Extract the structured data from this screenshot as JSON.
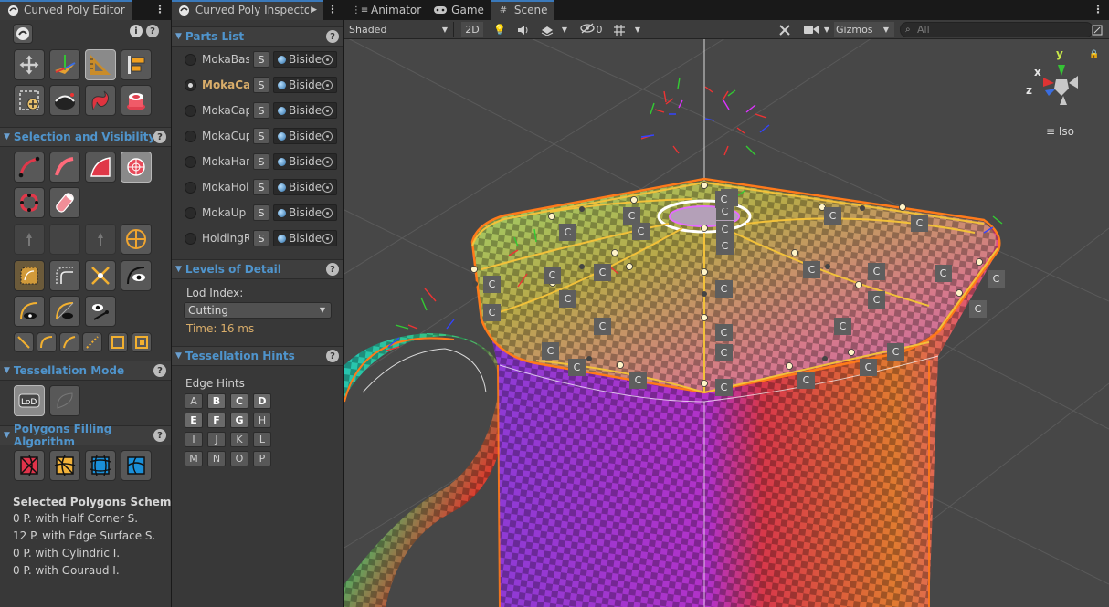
{
  "editor": {
    "tab_title": "Curved Poly Editor",
    "sections": {
      "selection": "Selection and Visibility",
      "tessellation_mode": "Tessellation Mode",
      "filling": "Polygons Filling Algorithm"
    },
    "schema_title": "Selected Polygons Schema",
    "schema_lines": [
      "0 P. with Half Corner S.",
      "12 P. with Edge Surface S.",
      "0 P. with Cylindric I.",
      "0 P. with Gouraud I."
    ]
  },
  "inspector": {
    "tab_title": "Curved Poly Inspector",
    "parts_list_title": "Parts List",
    "parts": [
      {
        "name": "MokaBase",
        "s": "S",
        "material": "Biside"
      },
      {
        "name": "MokaCap",
        "s": "S",
        "material": "Biside"
      },
      {
        "name": "MokaCap",
        "s": "S",
        "material": "Biside"
      },
      {
        "name": "MokaCup",
        "s": "S",
        "material": "Biside"
      },
      {
        "name": "MokaHandle",
        "s": "S",
        "material": "Biside"
      },
      {
        "name": "MokaHole",
        "s": "S",
        "material": "Biside"
      },
      {
        "name": "MokaUp",
        "s": "S",
        "material": "Biside"
      },
      {
        "name": "HoldingR",
        "s": "S",
        "material": "Biside"
      }
    ],
    "selected_part_index": 1,
    "lod_title": "Levels of Detail",
    "lod_label": "Lod Index:",
    "lod_value": "Cutting",
    "lod_time": "Time: 16 ms",
    "hints_title": "Tessellation Hints",
    "edge_hints_label": "Edge Hints",
    "edge_hints": [
      "A",
      "B",
      "C",
      "D",
      "E",
      "F",
      "G",
      "H",
      "I",
      "J",
      "K",
      "L",
      "M",
      "N",
      "O",
      "P"
    ],
    "active_hints": [
      "B",
      "C",
      "D",
      "E",
      "F",
      "G"
    ]
  },
  "scene": {
    "tabs": [
      "Animator",
      "Game",
      "Scene"
    ],
    "active_tab": "Scene",
    "shading": "Shaded",
    "mode_2d": "2D",
    "hidden_count": "0",
    "gizmos": "Gizmos",
    "search_placeholder": "All",
    "view_label": "Iso",
    "axes": {
      "x": "x",
      "y": "y",
      "z": "z"
    },
    "badge": "C"
  },
  "colors": {
    "accent": "#3a79bb",
    "section": "#4f94cc",
    "selected_part": "#d9ad6a",
    "outline": "#ff7a1a"
  }
}
